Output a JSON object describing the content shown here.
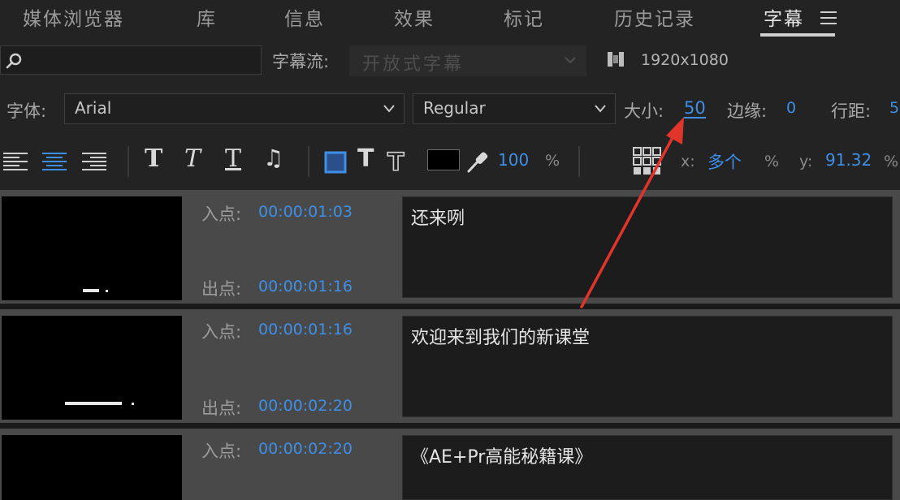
{
  "tabs": [
    {
      "label": "媒体浏览器",
      "active": false
    },
    {
      "label": "库",
      "active": false
    },
    {
      "label": "信息",
      "active": false
    },
    {
      "label": "效果",
      "active": false
    },
    {
      "label": "标记",
      "active": false
    },
    {
      "label": "历史记录",
      "active": false
    },
    {
      "label": "字幕",
      "active": true
    }
  ],
  "search": {
    "value": "",
    "placeholder": ""
  },
  "caption_stream": {
    "label": "字幕流:",
    "value": "开放式字幕"
  },
  "resolution": "1920x1080",
  "font": {
    "label": "字体:",
    "family": "Arial",
    "style": "Regular"
  },
  "size": {
    "label": "大小:",
    "value": "50"
  },
  "edge": {
    "label": "边缘:",
    "value": "0"
  },
  "line_spacing": {
    "label": "行距:",
    "value": "5"
  },
  "toolbar": {
    "opacity_value": "100",
    "opacity_unit": "%",
    "x_label": "x:",
    "x_value": "多个",
    "x_unit": "%",
    "y_label": "y:",
    "y_value": "91.32",
    "y_unit": "%"
  },
  "in_label": "入点:",
  "out_label": "出点:",
  "captions": [
    {
      "in": "00:00:01:03",
      "out": "00:00:01:16",
      "text": "还来咧"
    },
    {
      "in": "00:00:01:16",
      "out": "00:00:02:20",
      "text": "欢迎来到我们的新课堂"
    },
    {
      "in": "00:00:02:20",
      "out": "",
      "text": "《AE+Pr高能秘籍课》"
    }
  ],
  "colors": {
    "accent_blue": "#3f8fe6",
    "arrow_red": "#e0352b",
    "panel_bg": "#232323",
    "row_bg": "#494949"
  }
}
